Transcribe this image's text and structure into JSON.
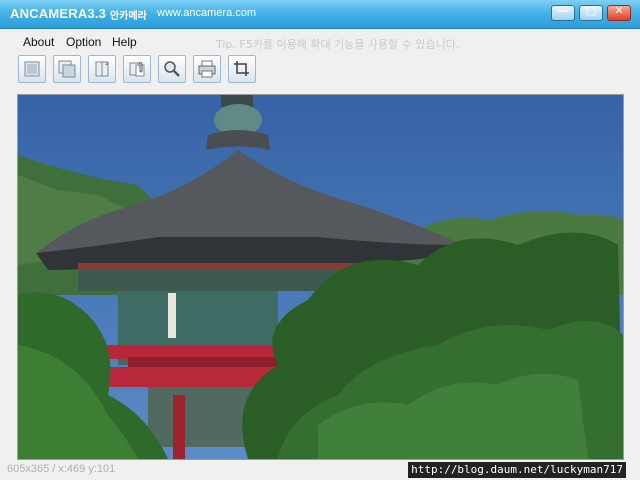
{
  "window": {
    "title": "ANCAMERA3.3",
    "subtitle": "안카메라",
    "url": "www.ancamera.com",
    "controls": {
      "minimize": "—",
      "maximize": "□",
      "close": "✕"
    }
  },
  "menu": {
    "items": [
      "About",
      "Option",
      "Help"
    ],
    "tip": "Tip. F5키를 이용해 확대 기능을 사용할 수 있습니다."
  },
  "toolbar": {
    "tools": [
      "capture-screen-icon",
      "capture-window-icon",
      "capture-region-icon",
      "clipboard-icon",
      "zoom-icon",
      "print-icon",
      "crop-icon"
    ]
  },
  "status": {
    "dimensions": "605x365",
    "coordinates": "x:469 y:101",
    "text": "605x365 / x:469 y:101"
  },
  "watermark": {
    "url": "http://blog.daum.net/luckyman717"
  },
  "colors": {
    "titlebar": "#3aa8e3",
    "sky": "#3d6fb0",
    "foliage": "#2f6a2a",
    "roof": "#5a5a5a",
    "railing": "#b8283a"
  }
}
